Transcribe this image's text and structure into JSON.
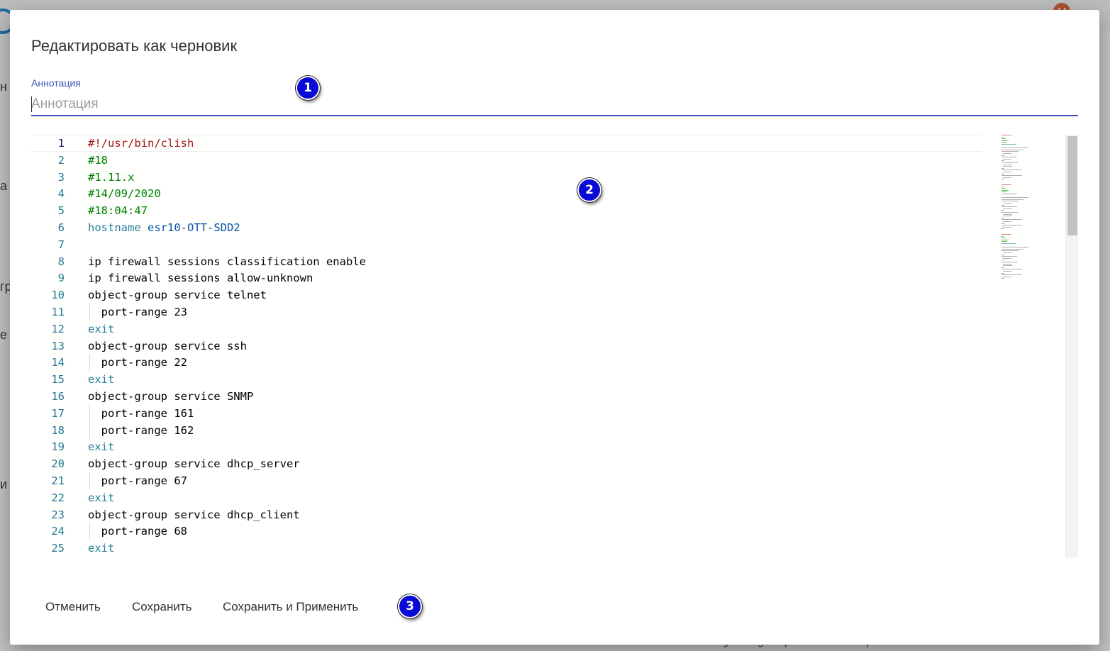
{
  "background": {
    "fragments": [
      "н",
      "а",
      "гр",
      "е",
      "и"
    ],
    "badge": "14",
    "code_fragment": "   object-group service ntp"
  },
  "dialog": {
    "title": "Редактировать как черновик",
    "annotation": {
      "label": "Аннотация",
      "placeholder": "Аннотация",
      "value": ""
    },
    "editor": {
      "lines": [
        {
          "n": "1",
          "text": "#!/usr/bin/clish",
          "cls": "t-red",
          "current": true
        },
        {
          "n": "2",
          "text": "#18",
          "cls": "t-green"
        },
        {
          "n": "3",
          "text": "#1.11.x",
          "cls": "t-green"
        },
        {
          "n": "4",
          "text": "#14/09/2020",
          "cls": "t-green"
        },
        {
          "n": "5",
          "text": "#18:04:47",
          "cls": "t-green"
        },
        {
          "n": "6",
          "text": "",
          "segments": [
            {
              "t": "hostname ",
              "c": "t-key"
            },
            {
              "t": "esr10-OTT-SDD2",
              "c": "t-val"
            }
          ]
        },
        {
          "n": "7",
          "text": ""
        },
        {
          "n": "8",
          "text": "ip firewall sessions classification enable"
        },
        {
          "n": "9",
          "text": "ip firewall sessions allow-unknown"
        },
        {
          "n": "10",
          "text": "object-group service telnet"
        },
        {
          "n": "11",
          "text": "  port-range 23",
          "indent": true
        },
        {
          "n": "12",
          "text": "exit",
          "cls": "t-key"
        },
        {
          "n": "13",
          "text": "object-group service ssh"
        },
        {
          "n": "14",
          "text": "  port-range 22",
          "indent": true
        },
        {
          "n": "15",
          "text": "exit",
          "cls": "t-key"
        },
        {
          "n": "16",
          "text": "object-group service SNMP"
        },
        {
          "n": "17",
          "text": "  port-range 161",
          "indent": true
        },
        {
          "n": "18",
          "text": "  port-range 162",
          "indent": true
        },
        {
          "n": "19",
          "text": "exit",
          "cls": "t-key"
        },
        {
          "n": "20",
          "text": "object-group service dhcp_server"
        },
        {
          "n": "21",
          "text": "  port-range 67",
          "indent": true
        },
        {
          "n": "22",
          "text": "exit",
          "cls": "t-key"
        },
        {
          "n": "23",
          "text": "object-group service dhcp_client"
        },
        {
          "n": "24",
          "text": "  port-range 68",
          "indent": true
        },
        {
          "n": "25",
          "text": "exit",
          "cls": "t-key"
        }
      ]
    },
    "actions": {
      "cancel": "Отменить",
      "save": "Сохранить",
      "save_apply": "Сохранить и Применить"
    }
  },
  "markers": [
    "1",
    "2",
    "3"
  ],
  "colors": {
    "accent": "#3f51b5",
    "marker": "#0a0ad6",
    "line_number": "#237893"
  }
}
